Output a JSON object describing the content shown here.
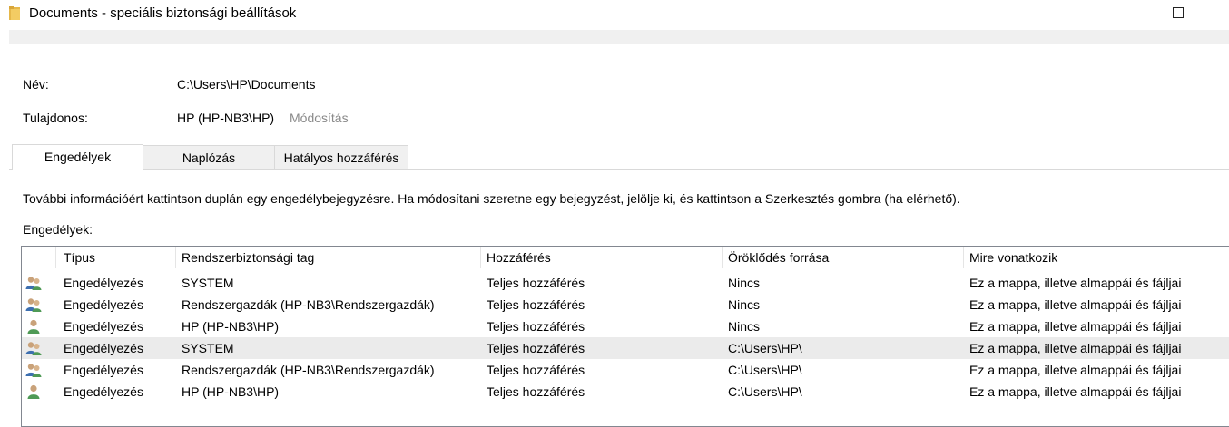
{
  "window": {
    "title": "Documents - speciális biztonsági beállítások",
    "folder_icon": "folder-icon",
    "controls": [
      "minimize-icon",
      "maximize-icon"
    ]
  },
  "info": {
    "name_label": "Név:",
    "name_value": "C:\\Users\\HP\\Documents",
    "owner_label": "Tulajdonos:",
    "owner_value": "HP (HP-NB3\\HP)",
    "change_link": "Módosítás"
  },
  "tabs": [
    {
      "label": "Engedélyek",
      "active": true
    },
    {
      "label": "Naplózás",
      "active": false
    },
    {
      "label": "Hatályos hozzáférés",
      "active": false
    }
  ],
  "instructions": "További információért kattintson duplán egy engedélybejegyzésre. Ha módosítani szeretne egy bejegyzést, jelölje ki, és kattintson a Szerkesztés gombra (ha elérhető).",
  "permissions_label": "Engedélyek:",
  "columns": {
    "type": "Típus",
    "principal": "Rendszerbiztonsági tag",
    "access": "Hozzáférés",
    "inherited": "Öröklődés forrása",
    "applies": "Mire vonatkozik"
  },
  "rows": [
    {
      "icon": "group-users-icon",
      "type": "Engedélyezés",
      "principal": "SYSTEM",
      "access": "Teljes hozzáférés",
      "inherited": "Nincs",
      "applies": "Ez a mappa, illetve almappái és fájljai"
    },
    {
      "icon": "group-users-icon",
      "type": "Engedélyezés",
      "principal": "Rendszergazdák (HP-NB3\\Rendszergazdák)",
      "access": "Teljes hozzáférés",
      "inherited": "Nincs",
      "applies": "Ez a mappa, illetve almappái és fájljai"
    },
    {
      "icon": "single-user-icon",
      "type": "Engedélyezés",
      "principal": "HP (HP-NB3\\HP)",
      "access": "Teljes hozzáférés",
      "inherited": "Nincs",
      "applies": "Ez a mappa, illetve almappái és fájljai"
    },
    {
      "icon": "group-users-icon",
      "type": "Engedélyezés",
      "principal": "SYSTEM",
      "access": "Teljes hozzáférés",
      "inherited": "C:\\Users\\HP\\",
      "applies": "Ez a mappa, illetve almappái és fájljai",
      "selected": true
    },
    {
      "icon": "group-users-icon",
      "type": "Engedélyezés",
      "principal": "Rendszergazdák (HP-NB3\\Rendszergazdák)",
      "access": "Teljes hozzáférés",
      "inherited": "C:\\Users\\HP\\",
      "applies": "Ez a mappa, illetve almappái és fájljai"
    },
    {
      "icon": "single-user-icon",
      "type": "Engedélyezés",
      "principal": "HP (HP-NB3\\HP)",
      "access": "Teljes hozzáférés",
      "inherited": "C:\\Users\\HP\\",
      "applies": "Ez a mappa, illetve almappái és fájljai"
    }
  ]
}
